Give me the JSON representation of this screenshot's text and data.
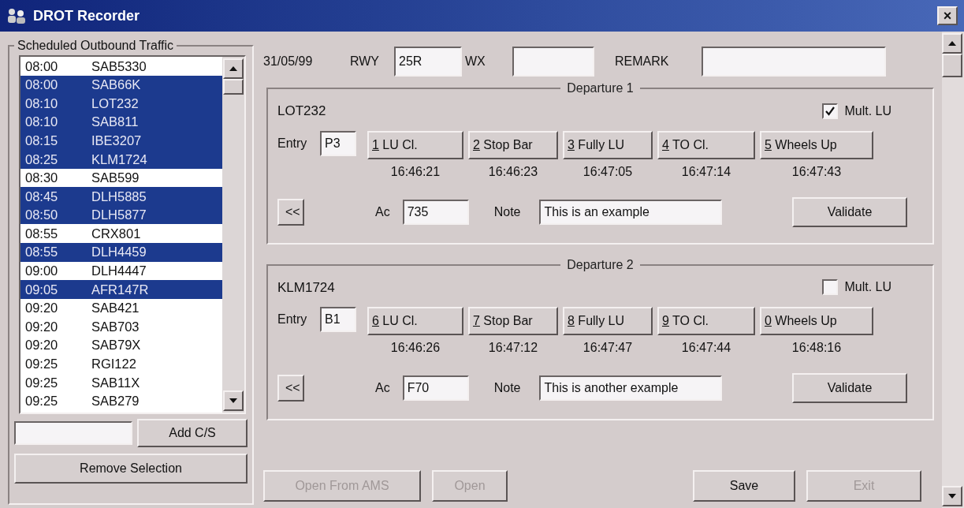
{
  "window": {
    "title": "DROT Recorder",
    "close": "×"
  },
  "traffic": {
    "title": "Scheduled Outbound Traffic",
    "rows": [
      {
        "time": "08:00",
        "callsign": "SAB5330",
        "selected": false
      },
      {
        "time": "08:00",
        "callsign": "SAB66K",
        "selected": true
      },
      {
        "time": "08:10",
        "callsign": "LOT232",
        "selected": true
      },
      {
        "time": "08:10",
        "callsign": "SAB811",
        "selected": true
      },
      {
        "time": "08:15",
        "callsign": "IBE3207",
        "selected": true
      },
      {
        "time": "08:25",
        "callsign": "KLM1724",
        "selected": true
      },
      {
        "time": "08:30",
        "callsign": "SAB599",
        "selected": false
      },
      {
        "time": "08:45",
        "callsign": "DLH5885",
        "selected": true
      },
      {
        "time": "08:50",
        "callsign": "DLH5877",
        "selected": true
      },
      {
        "time": "08:55",
        "callsign": "CRX801",
        "selected": false
      },
      {
        "time": "08:55",
        "callsign": "DLH4459",
        "selected": true
      },
      {
        "time": "09:00",
        "callsign": "DLH4447",
        "selected": false
      },
      {
        "time": "09:05",
        "callsign": "AFR147R",
        "selected": true
      },
      {
        "time": "09:20",
        "callsign": "SAB421",
        "selected": false
      },
      {
        "time": "09:20",
        "callsign": "SAB703",
        "selected": false
      },
      {
        "time": "09:20",
        "callsign": "SAB79X",
        "selected": false
      },
      {
        "time": "09:25",
        "callsign": "RGI122",
        "selected": false
      },
      {
        "time": "09:25",
        "callsign": "SAB11X",
        "selected": false
      },
      {
        "time": "09:25",
        "callsign": "SAB279",
        "selected": false
      }
    ],
    "add_button": "Add C/S",
    "remove_button": "Remove Selection"
  },
  "header": {
    "date": "31/05/99",
    "rwy_label": "RWY",
    "rwy_value": "25R",
    "wx_label": "WX",
    "remark_label": "REMARK"
  },
  "departures": [
    {
      "title": "Departure 1",
      "callsign": "LOT232",
      "mult_lu": {
        "label": "Mult. LU",
        "checked": true
      },
      "entry_label": "Entry",
      "entry": "P3",
      "steps": [
        {
          "key": "1",
          "label": "LU Cl.",
          "time": "16:46:21"
        },
        {
          "key": "2",
          "label": "Stop Bar",
          "time": "16:46:23"
        },
        {
          "key": "3",
          "label": "Fully LU",
          "time": "16:47:05"
        },
        {
          "key": "4",
          "label": "TO Cl.",
          "time": "16:47:14"
        },
        {
          "key": "5",
          "label": "Wheels Up",
          "time": "16:47:43"
        }
      ],
      "back": "<<",
      "ac_label": "Ac",
      "ac": "735",
      "note_label": "Note",
      "note": "This is an example",
      "validate": "Validate"
    },
    {
      "title": "Departure 2",
      "callsign": "KLM1724",
      "mult_lu": {
        "label": "Mult. LU",
        "checked": false
      },
      "entry_label": "Entry",
      "entry": "B1",
      "steps": [
        {
          "key": "6",
          "label": "LU Cl.",
          "time": "16:46:26"
        },
        {
          "key": "7",
          "label": "Stop Bar",
          "time": "16:47:12"
        },
        {
          "key": "8",
          "label": "Fully LU",
          "time": "16:47:47"
        },
        {
          "key": "9",
          "label": "TO Cl.",
          "time": "16:47:44"
        },
        {
          "key": "0",
          "label": "Wheels Up",
          "time": "16:48:16"
        }
      ],
      "back": "<<",
      "ac_label": "Ac",
      "ac": "F70",
      "note_label": "Note",
      "note": "This is another example",
      "validate": "Validate"
    }
  ],
  "footer": [
    {
      "label": "Open From AMS",
      "disabled": true
    },
    {
      "label": "Open",
      "disabled": true
    },
    {
      "label": "Save",
      "disabled": false
    },
    {
      "label": "Exit",
      "disabled": true
    }
  ]
}
